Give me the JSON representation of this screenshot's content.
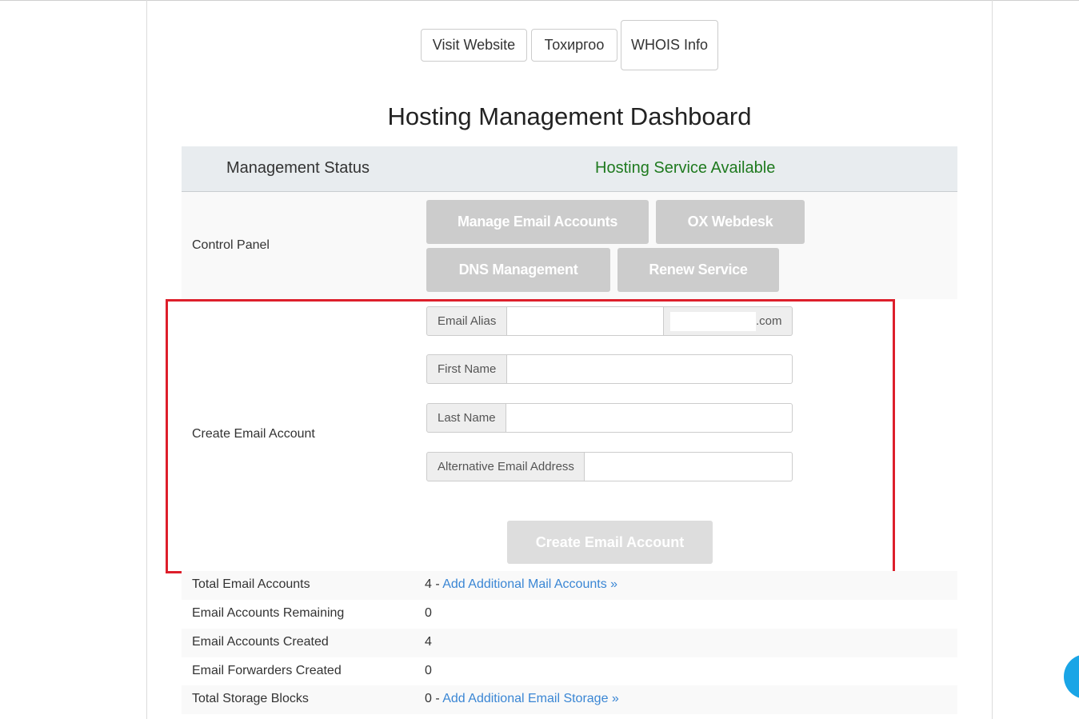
{
  "top_buttons": {
    "visit_website": "Visit Website",
    "tokhirgoo": "Тохиргоо",
    "whois_info": "WHOIS Info"
  },
  "page_title": "Hosting Management Dashboard",
  "status": {
    "label": "Management Status",
    "value": "Hosting Service Available",
    "value_color": "#1f7a1f"
  },
  "control_panel": {
    "label": "Control Panel",
    "buttons": {
      "manage_email": "Manage Email Accounts",
      "ox_webdesk": "OX Webdesk",
      "dns_management": "DNS Management",
      "renew_service": "Renew Service"
    }
  },
  "create_email": {
    "label": "Create Email Account",
    "email_alias_label": "Email Alias",
    "email_alias_value": "",
    "domain_suffix": ".com",
    "first_name_label": "First Name",
    "first_name_value": "",
    "last_name_label": "Last Name",
    "last_name_value": "",
    "alt_email_label": "Alternative Email Address",
    "alt_email_value": "",
    "submit_label": "Create Email Account"
  },
  "stats": {
    "total_email_accounts": {
      "label": "Total Email Accounts",
      "value": "4 - ",
      "link": "Add Additional Mail Accounts »"
    },
    "remaining": {
      "label": "Email Accounts Remaining",
      "value": "0"
    },
    "created": {
      "label": "Email Accounts Created",
      "value": "4"
    },
    "forwarders": {
      "label": "Email Forwarders Created",
      "value": "0"
    },
    "storage_blocks": {
      "label": "Total Storage Blocks",
      "value": "0 - ",
      "link": "Add Additional Email Storage »"
    }
  },
  "colors": {
    "highlight_border": "#dd1f2b",
    "link": "#3a86d4",
    "disabled_button": "#cccccc"
  }
}
